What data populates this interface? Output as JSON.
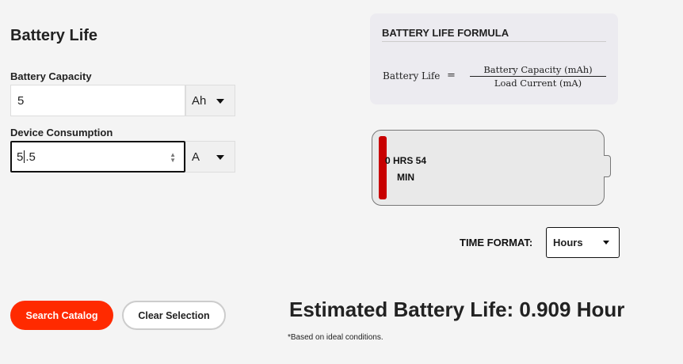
{
  "page": {
    "title": "Battery Life"
  },
  "capacity": {
    "label": "Battery Capacity",
    "value": "5",
    "unit": "Ah"
  },
  "consumption": {
    "label": "Device Consumption",
    "value_before_caret": "5",
    "value_after_caret": ".5",
    "unit": "A"
  },
  "formula": {
    "title": "BATTERY LIFE FORMULA",
    "lhs": "Battery Life",
    "equals": "=",
    "numerator": "Battery Capacity (mAh)",
    "denominator": "Load Current (mA)"
  },
  "battery": {
    "line1": "0 HRS 54",
    "line2": "MIN",
    "fill_color": "#c80000"
  },
  "time_format": {
    "label": "TIME FORMAT:",
    "selected": "Hours"
  },
  "buttons": {
    "search": "Search Catalog",
    "clear": "Clear Selection"
  },
  "result": {
    "text": "Estimated Battery Life: 0.909 Hour",
    "note": "*Based on ideal conditions."
  },
  "colors": {
    "accent": "#ff2a00",
    "background": "#f4f4f4",
    "formula_card": "#ecebf0"
  }
}
